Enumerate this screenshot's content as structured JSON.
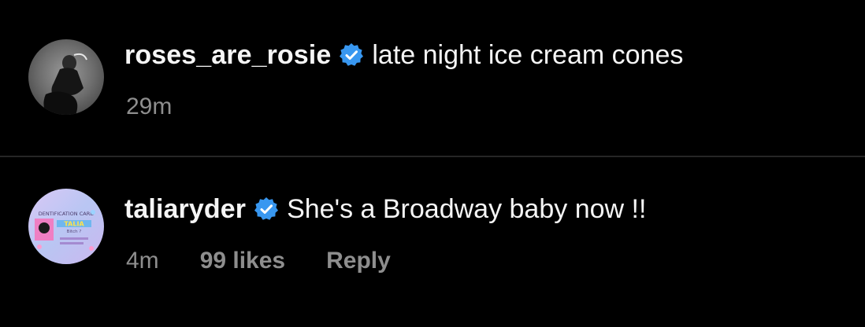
{
  "colors": {
    "background": "#000000",
    "primary_text": "#f5f5f5",
    "secondary_text": "#8e8e8e",
    "divider": "#262626",
    "verified_badge": "#3897f0"
  },
  "comments": [
    {
      "avatar_icon": "user-avatar-photo",
      "username": "roses_are_rosie",
      "verified_icon": "verified-badge-icon",
      "text": "late night ice cream cones",
      "time": "29m"
    },
    {
      "avatar_icon": "user-avatar-id-card",
      "avatar_text": {
        "line1": "DENTIFICATION CARD",
        "line2": "TALIA",
        "line3": "Bitch ?"
      },
      "username": "taliaryder",
      "verified_icon": "verified-badge-icon",
      "text": "She's a Broadway baby now !!",
      "time": "4m",
      "likes": "99 likes",
      "reply_label": "Reply"
    }
  ]
}
